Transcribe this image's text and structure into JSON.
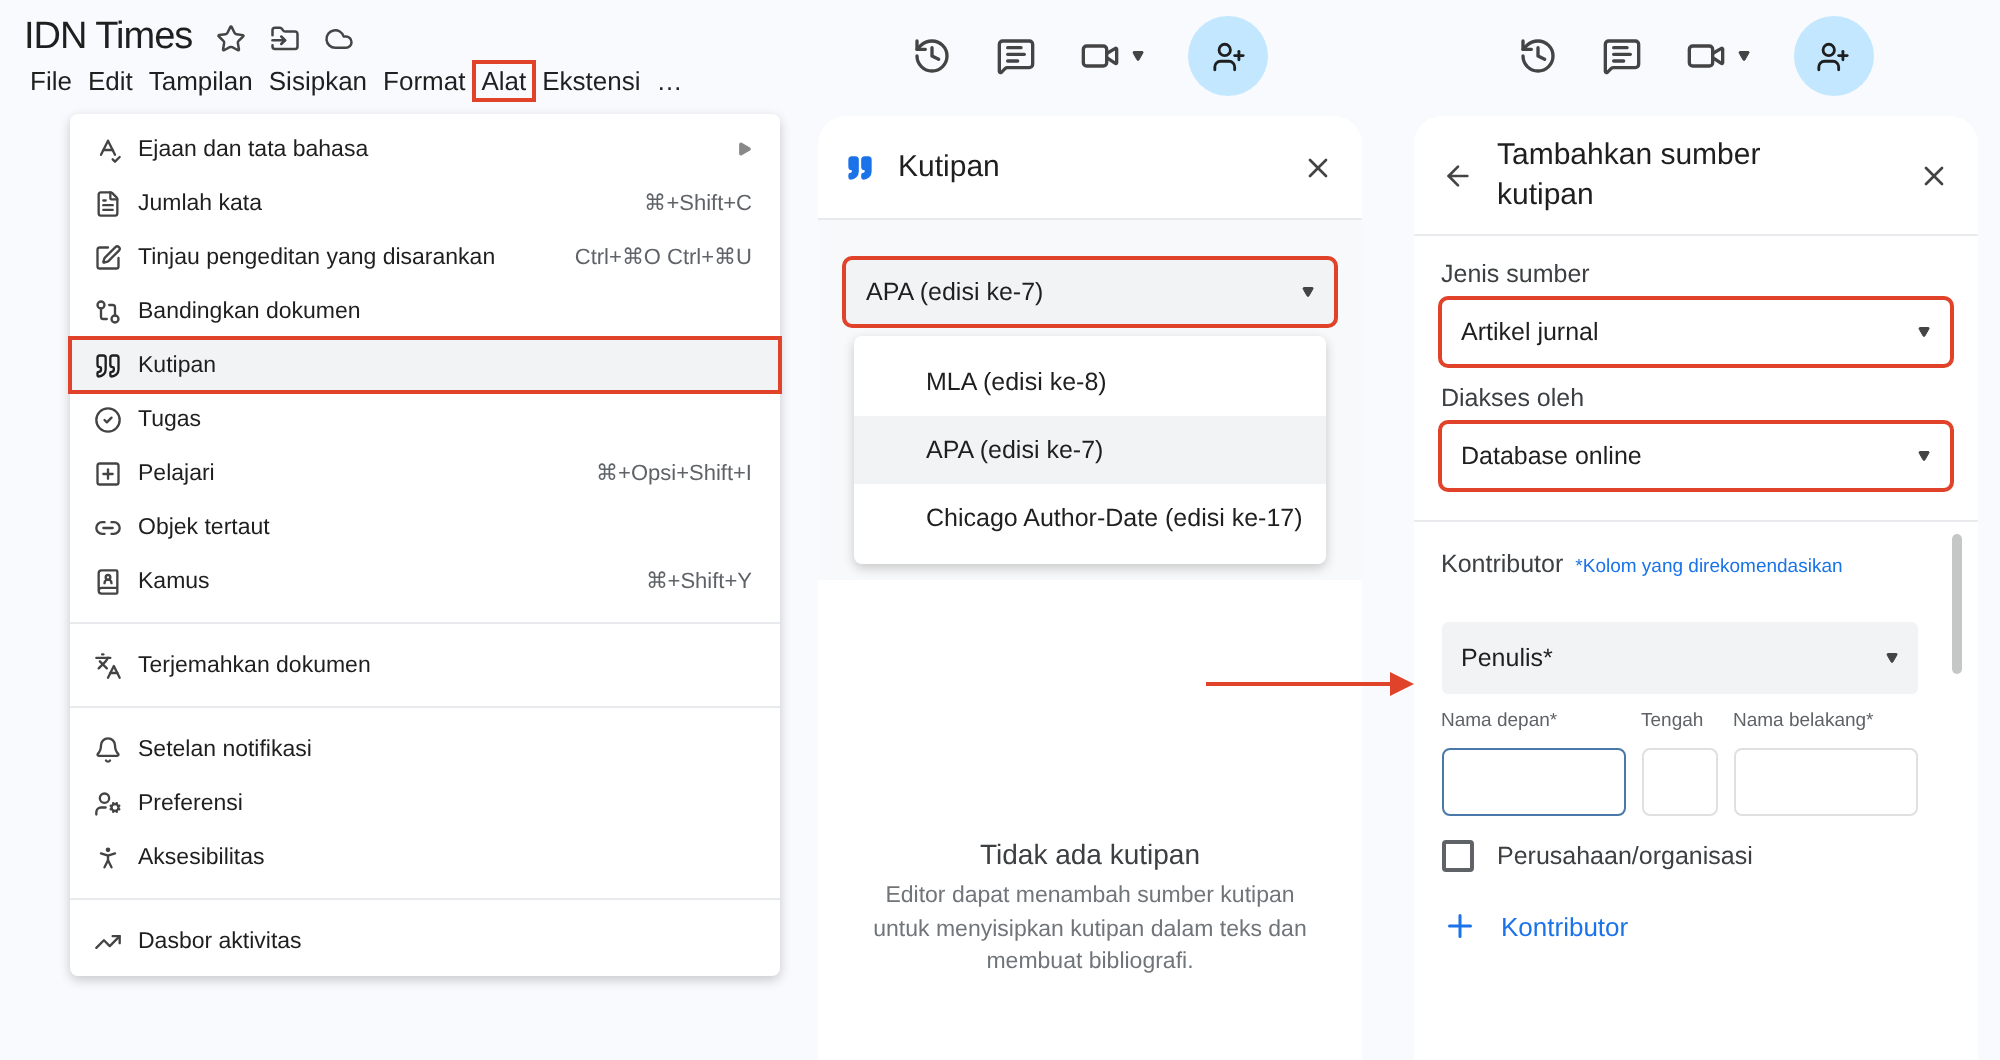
{
  "left": {
    "doc_title": "IDN Times",
    "menu_bar": [
      {
        "label": "File",
        "highlighted": false
      },
      {
        "label": "Edit",
        "highlighted": false
      },
      {
        "label": "Tampilan",
        "highlighted": false
      },
      {
        "label": "Sisipkan",
        "highlighted": false
      },
      {
        "label": "Format",
        "highlighted": false
      },
      {
        "label": "Alat",
        "highlighted": true
      },
      {
        "label": "Ekstensi",
        "highlighted": false
      },
      {
        "label": "…",
        "highlighted": false
      }
    ],
    "tools_menu": [
      [
        {
          "label": "Ejaan dan tata bahasa",
          "submenu": true,
          "highlighted": false
        },
        {
          "label": "Jumlah kata",
          "shortcut": "⌘+Shift+C",
          "highlighted": false
        },
        {
          "label": "Tinjau pengeditan yang disarankan",
          "shortcut": "Ctrl+⌘O Ctrl+⌘U",
          "highlighted": false
        },
        {
          "label": "Bandingkan dokumen",
          "highlighted": false
        },
        {
          "label": "Kutipan",
          "highlighted": true
        },
        {
          "label": "Tugas",
          "highlighted": false
        },
        {
          "label": "Pelajari",
          "shortcut": "⌘+Opsi+Shift+I",
          "highlighted": false
        },
        {
          "label": "Objek tertaut",
          "highlighted": false
        },
        {
          "label": "Kamus",
          "shortcut": "⌘+Shift+Y",
          "highlighted": false
        }
      ],
      [
        {
          "label": "Terjemahkan dokumen",
          "highlighted": false
        }
      ],
      [
        {
          "label": "Setelan notifikasi",
          "highlighted": false
        },
        {
          "label": "Preferensi",
          "highlighted": false
        },
        {
          "label": "Aksesibilitas",
          "highlighted": false
        }
      ],
      [
        {
          "label": "Dasbor aktivitas",
          "highlighted": false
        }
      ]
    ]
  },
  "citation_panel": {
    "title": "Kutipan",
    "style_select": {
      "value": "APA (edisi ke-7)",
      "highlighted": true
    },
    "style_options": [
      {
        "label": "MLA (edisi ke-8)",
        "selected": false
      },
      {
        "label": "APA (edisi ke-7)",
        "selected": true
      },
      {
        "label": "Chicago Author-Date (edisi ke-17)",
        "selected": false
      }
    ],
    "empty_state": {
      "title": "Tidak ada kutipan",
      "message": "Editor dapat menambah sumber kutipan untuk menyisipkan kutipan dalam teks dan membuat bibliografi."
    }
  },
  "source_panel": {
    "title": "Tambahkan sumber kutipan",
    "fields": [
      {
        "label": "Jenis sumber",
        "value": "Artikel jurnal",
        "highlighted": true
      },
      {
        "label": "Diakses oleh",
        "value": "Database online",
        "highlighted": true
      }
    ],
    "contributors": {
      "title": "Kontributor",
      "note": "*Kolom yang direkomendasikan",
      "role": "Penulis*",
      "name_fields": [
        {
          "label": "Nama depan*",
          "focused": true
        },
        {
          "label": "Tengah",
          "focused": false
        },
        {
          "label": "Nama belakang*",
          "focused": false
        }
      ],
      "organization": {
        "label": "Perusahaan/organisasi",
        "checked": false
      },
      "add_button": "Kontributor"
    }
  }
}
